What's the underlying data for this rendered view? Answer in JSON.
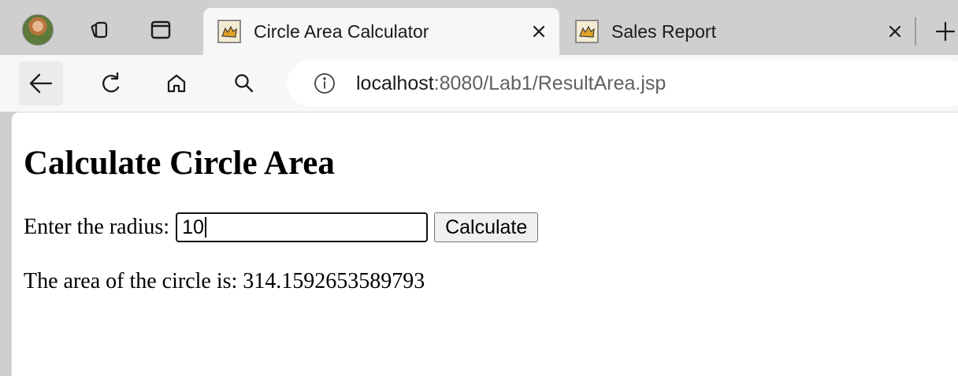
{
  "browser": {
    "tabs": [
      {
        "title": "Circle Area Calculator",
        "active": true,
        "favicon": "tomcat-icon"
      },
      {
        "title": "Sales Report",
        "active": false,
        "favicon": "tomcat-icon"
      }
    ],
    "close_glyph": "✕",
    "address": {
      "host": "localhost",
      "rest": ":8080/Lab1/ResultArea.jsp"
    }
  },
  "page": {
    "title": "Calculate Circle Area",
    "radius_label": "Enter the radius:",
    "radius_value": "10",
    "calculate_label": "Calculate",
    "result_text": "The area of the circle is: 314.1592653589793"
  },
  "colors": {
    "tab_strip": "#cfcfcf",
    "toolbar": "#f7f7f7",
    "content": "#ffffff"
  }
}
